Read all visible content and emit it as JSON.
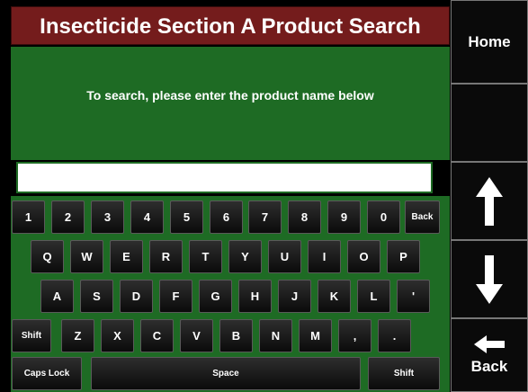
{
  "title": "Insecticide Section A Product Search",
  "prompt": "To search, please enter the product name below",
  "search": {
    "value": "",
    "placeholder": ""
  },
  "side": {
    "home_label": "Home",
    "back_label": "Back"
  },
  "keyboard": {
    "row1": [
      "1",
      "2",
      "3",
      "4",
      "5",
      "6",
      "7",
      "8",
      "9",
      "0",
      "Back"
    ],
    "row2": [
      "Q",
      "W",
      "E",
      "R",
      "T",
      "Y",
      "U",
      "I",
      "O",
      "P"
    ],
    "row3": [
      "A",
      "S",
      "D",
      "F",
      "G",
      "H",
      "J",
      "K",
      "L",
      "'"
    ],
    "row4": [
      "Shift",
      "Z",
      "X",
      "C",
      "V",
      "B",
      "N",
      "M",
      ",",
      "."
    ],
    "row5": [
      "Caps Lock",
      "Space",
      "Shift"
    ]
  },
  "colors": {
    "title_bg": "#741c1c",
    "panel_bg": "#1e6b24",
    "key_bg": "#1a1a1a",
    "text": "#ffffff"
  },
  "icons": {
    "up": "arrow-up-icon",
    "down": "arrow-down-icon",
    "back": "arrow-left-icon"
  }
}
